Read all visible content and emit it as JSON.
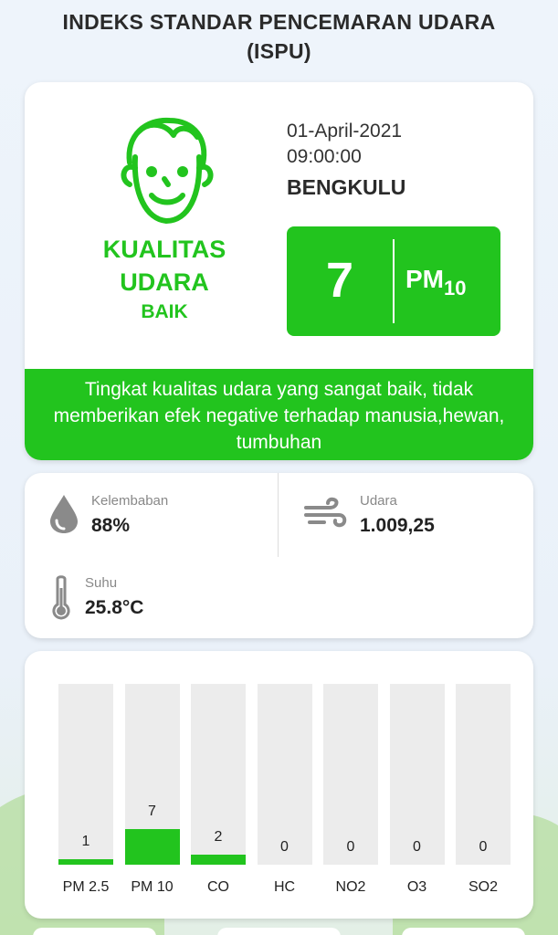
{
  "header": {
    "title_line1": "INDEKS STANDAR PENCEMARAN UDARA",
    "title_line2": "(ISPU)"
  },
  "summary": {
    "face_icon": "happy-face-icon",
    "quality_line1": "KUALITAS",
    "quality_line2": "UDARA",
    "quality_status": "BAIK",
    "date": "01-April-2021",
    "time": "09:00:00",
    "city": "BENGKULU",
    "aqi_value": "7",
    "aqi_unit_main": "PM",
    "aqi_unit_sub": "10",
    "description": "Tingkat kualitas udara yang sangat baik, tidak memberikan efek negative terhadap manusia,hewan, tumbuhan",
    "status_color": "#22c41e"
  },
  "weather": {
    "humidity": {
      "icon": "water-drop-icon",
      "label": "Kelembaban",
      "value": "88%"
    },
    "air": {
      "icon": "wind-icon",
      "label": "Udara",
      "value": "1.009,25"
    },
    "temperature": {
      "icon": "thermometer-icon",
      "label": "Suhu",
      "value": "25.8°C"
    }
  },
  "chart_data": {
    "type": "bar",
    "categories": [
      "PM 2.5",
      "PM 10",
      "CO",
      "HC",
      "NO2",
      "O3",
      "SO2"
    ],
    "values": [
      1,
      7,
      2,
      0,
      0,
      0,
      0
    ],
    "value_labels": [
      "1",
      "7",
      "2",
      "0",
      "0",
      "0",
      "0"
    ],
    "ylim": [
      0,
      36
    ],
    "title": "",
    "xlabel": "",
    "ylabel": "",
    "bar_color": "#22c41e",
    "track_color": "#ececec"
  }
}
